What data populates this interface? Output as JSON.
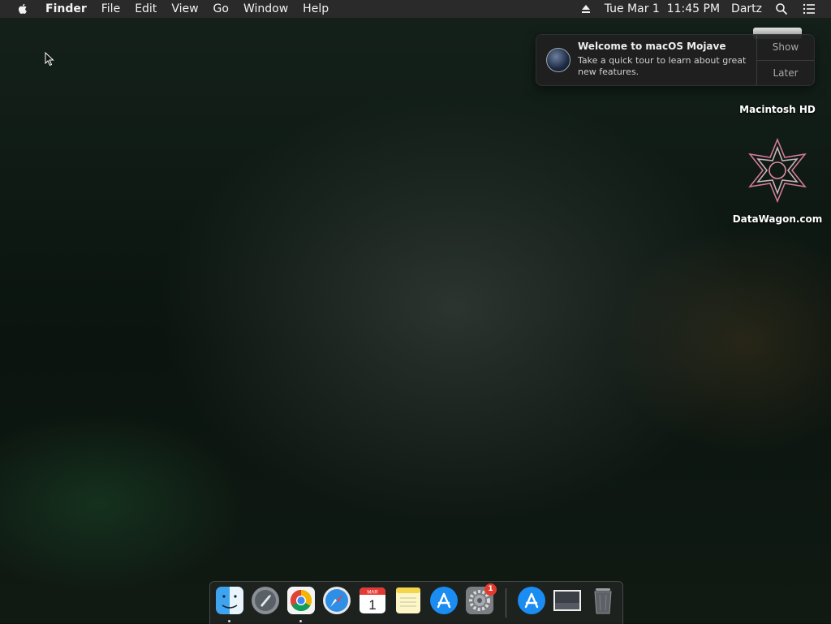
{
  "menubar": {
    "app_name": "Finder",
    "menus": [
      "File",
      "Edit",
      "View",
      "Go",
      "Window",
      "Help"
    ],
    "clock": "Tue Mar 1  11:45 PM",
    "user": "Dartz",
    "icons": [
      "apple-icon",
      "eject-icon",
      "spotlight-icon",
      "notification-center-icon"
    ]
  },
  "notification": {
    "title": "Welcome to macOS Mojave",
    "body": "Take a quick tour to learn about great new features.",
    "show_label": "Show",
    "later_label": "Later"
  },
  "desktop": {
    "icons": [
      {
        "label": "Macintosh HD",
        "icon": "hard-drive-icon"
      },
      {
        "label": "DataWagon.com",
        "icon": "datawagon-logo-icon"
      }
    ]
  },
  "dock": {
    "apps": [
      {
        "name": "Finder",
        "running": true
      },
      {
        "name": "Launchpad",
        "running": false
      },
      {
        "name": "Google Chrome",
        "running": true
      },
      {
        "name": "Safari",
        "running": false
      },
      {
        "name": "Calendar",
        "running": false,
        "month": "MAR",
        "day": "1"
      },
      {
        "name": "Notes",
        "running": false
      },
      {
        "name": "App Store",
        "running": false
      },
      {
        "name": "System Preferences",
        "running": false,
        "badge": "1"
      },
      {
        "name": "App Store",
        "running": false
      },
      {
        "name": "Preview",
        "running": false
      },
      {
        "name": "Trash",
        "running": false
      }
    ]
  },
  "colors": {
    "menubar_bg": "#2a2a2a",
    "notification_bg": "#202020",
    "badge_red": "#e23b2e"
  }
}
